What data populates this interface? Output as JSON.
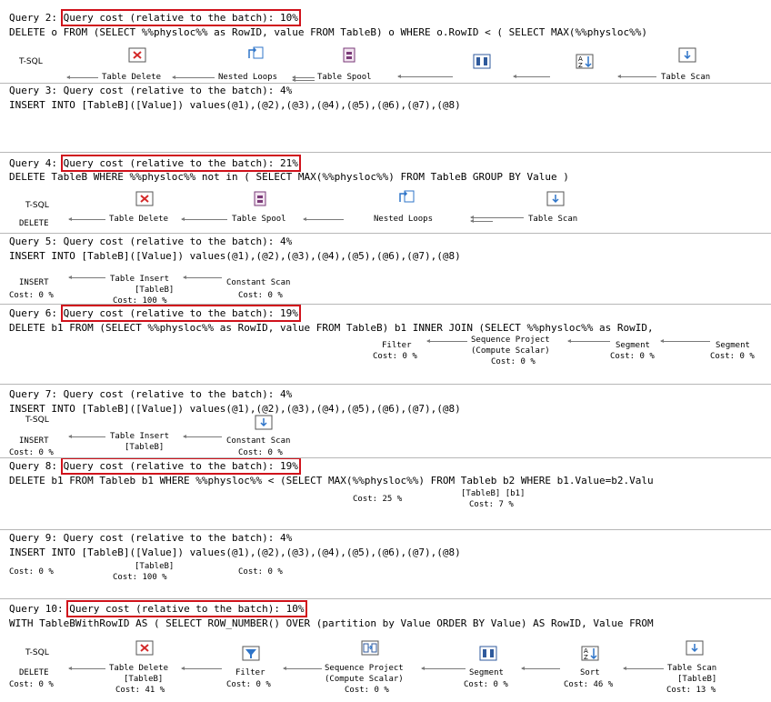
{
  "queries": [
    {
      "header_prefix": "Query 2: ",
      "cost_label": "Query cost (relative to the batch): 10%",
      "sql": "DELETE o FROM (SELECT %%physloc%% as RowID, value FROM TableB) o WHERE o.RowID < ( SELECT MAX(%%physloc%%)",
      "plan": {
        "label": "T-SQL",
        "ops": [
          "Table Delete",
          "Nested Loops",
          "Table Spool",
          "",
          "",
          "Table Scan"
        ]
      }
    },
    {
      "header_prefix": "Query 3: ",
      "cost_label": "Query cost (relative to the batch): 4%",
      "sql": "INSERT INTO [TableB]([Value]) values(@1),(@2),(@3),(@4),(@5),(@6),(@7),(@8)"
    },
    {
      "header_prefix": "Query 4: ",
      "cost_label": "Query cost (relative to the batch): 21%",
      "sql": "DELETE TableB WHERE %%physloc%% not in ( SELECT MAX(%%physloc%%) FROM TableB GROUP BY Value )",
      "plan": {
        "label": "T-SQL",
        "root": "DELETE",
        "ops": [
          "Table Delete",
          "Table Spool",
          "Nested Loops",
          "Table Scan"
        ]
      }
    },
    {
      "header_prefix": "Query 5: ",
      "cost_label": "Query cost (relative to the batch): 4%",
      "sql": "INSERT INTO [TableB]([Value]) values(@1),(@2),(@3),(@4),(@5),(@6),(@7),(@8)",
      "plan": {
        "root": "INSERT",
        "root_cost": "Cost: 0 %",
        "insert": "Table Insert",
        "insert_table": "[TableB]",
        "insert_cost": "Cost: 100 %",
        "scan": "Constant Scan",
        "scan_cost": "Cost: 0 %"
      }
    },
    {
      "header_prefix": "Query 6: ",
      "cost_label": "Query cost (relative to the batch): 19%",
      "sql": "DELETE b1 FROM (SELECT %%physloc%% as RowID, value FROM TableB) b1 INNER JOIN (SELECT %%physloc%% as RowID,",
      "plan": {
        "filter": "Filter",
        "filter_cost": "Cost: 0 %",
        "seq": "Sequence Project",
        "seq_sub": "(Compute Scalar)",
        "seq_cost": "Cost: 0 %",
        "seg1": "Segment",
        "seg1_cost": "Cost: 0 %",
        "seg2": "Segment",
        "seg2_cost": "Cost: 0 %"
      }
    },
    {
      "header_prefix": "Query 7: ",
      "cost_label": "Query cost (relative to the batch): 4%",
      "sql": "INSERT INTO [TableB]([Value]) values(@1),(@2),(@3),(@4),(@5),(@6),(@7),(@8)",
      "plan": {
        "label": "T-SQL",
        "root": "INSERT",
        "root_cost": "Cost: 0 %",
        "insert": "Table Insert",
        "insert_table": "[TableB]",
        "scan": "Constant Scan",
        "scan_cost": "Cost: 0 %"
      }
    },
    {
      "header_prefix": "Query 8: ",
      "cost_label": "Query cost (relative to the batch): 19%",
      "sql": "DELETE b1 FROM Tableb b1 WHERE %%physloc%% < (SELECT MAX(%%physloc%%) FROM Tableb b2 WHERE b1.Value=b2.Valu",
      "plan": {
        "cost_a": "Cost: 25 %",
        "table": "[TableB] [b1]",
        "cost_b": "Cost: 7 %"
      }
    },
    {
      "header_prefix": "Query 9: ",
      "cost_label": "Query cost (relative to the batch): 4%",
      "sql": "INSERT INTO [TableB]([Value]) values(@1),(@2),(@3),(@4),(@5),(@6),(@7),(@8)",
      "plan": {
        "root_cost": "Cost: 0 %",
        "insert_table": "[TableB]",
        "insert_cost": "Cost: 100 %",
        "scan_cost": "Cost: 0 %"
      }
    },
    {
      "header_prefix": "Query 10: ",
      "cost_label": "Query cost (relative to the batch): 10%",
      "sql": "WITH TableBWithRowID AS ( SELECT ROW_NUMBER() OVER (partition by Value ORDER BY Value) AS RowID, Value FROM",
      "plan": {
        "label": "T-SQL",
        "root": "DELETE",
        "root_cost": "Cost: 0 %",
        "del": "Table Delete",
        "del_table": "[TableB]",
        "del_cost": "Cost: 41 %",
        "filter": "Filter",
        "filter_cost": "Cost: 0 %",
        "seq": "Sequence Project",
        "seq_sub": "(Compute Scalar)",
        "seq_cost": "Cost: 0 %",
        "seg": "Segment",
        "seg_cost": "Cost: 0 %",
        "sort": "Sort",
        "sort_cost": "Cost: 46 %",
        "scan": "Table Scan",
        "scan_table": "[TableB]",
        "scan_cost": "Cost: 13 %"
      }
    }
  ],
  "icons": {
    "table_delete": "table-delete-icon",
    "nested_loops": "nested-loops-icon",
    "table_spool": "table-spool-icon",
    "segment": "segment-icon",
    "sort": "sort-icon",
    "table_scan": "table-scan-icon",
    "filter": "filter-icon",
    "sequence_project": "sequence-project-icon"
  },
  "colors": {
    "highlight": "#d0121b",
    "icon_blue": "#2f75c9",
    "icon_red": "#d42a2a"
  }
}
